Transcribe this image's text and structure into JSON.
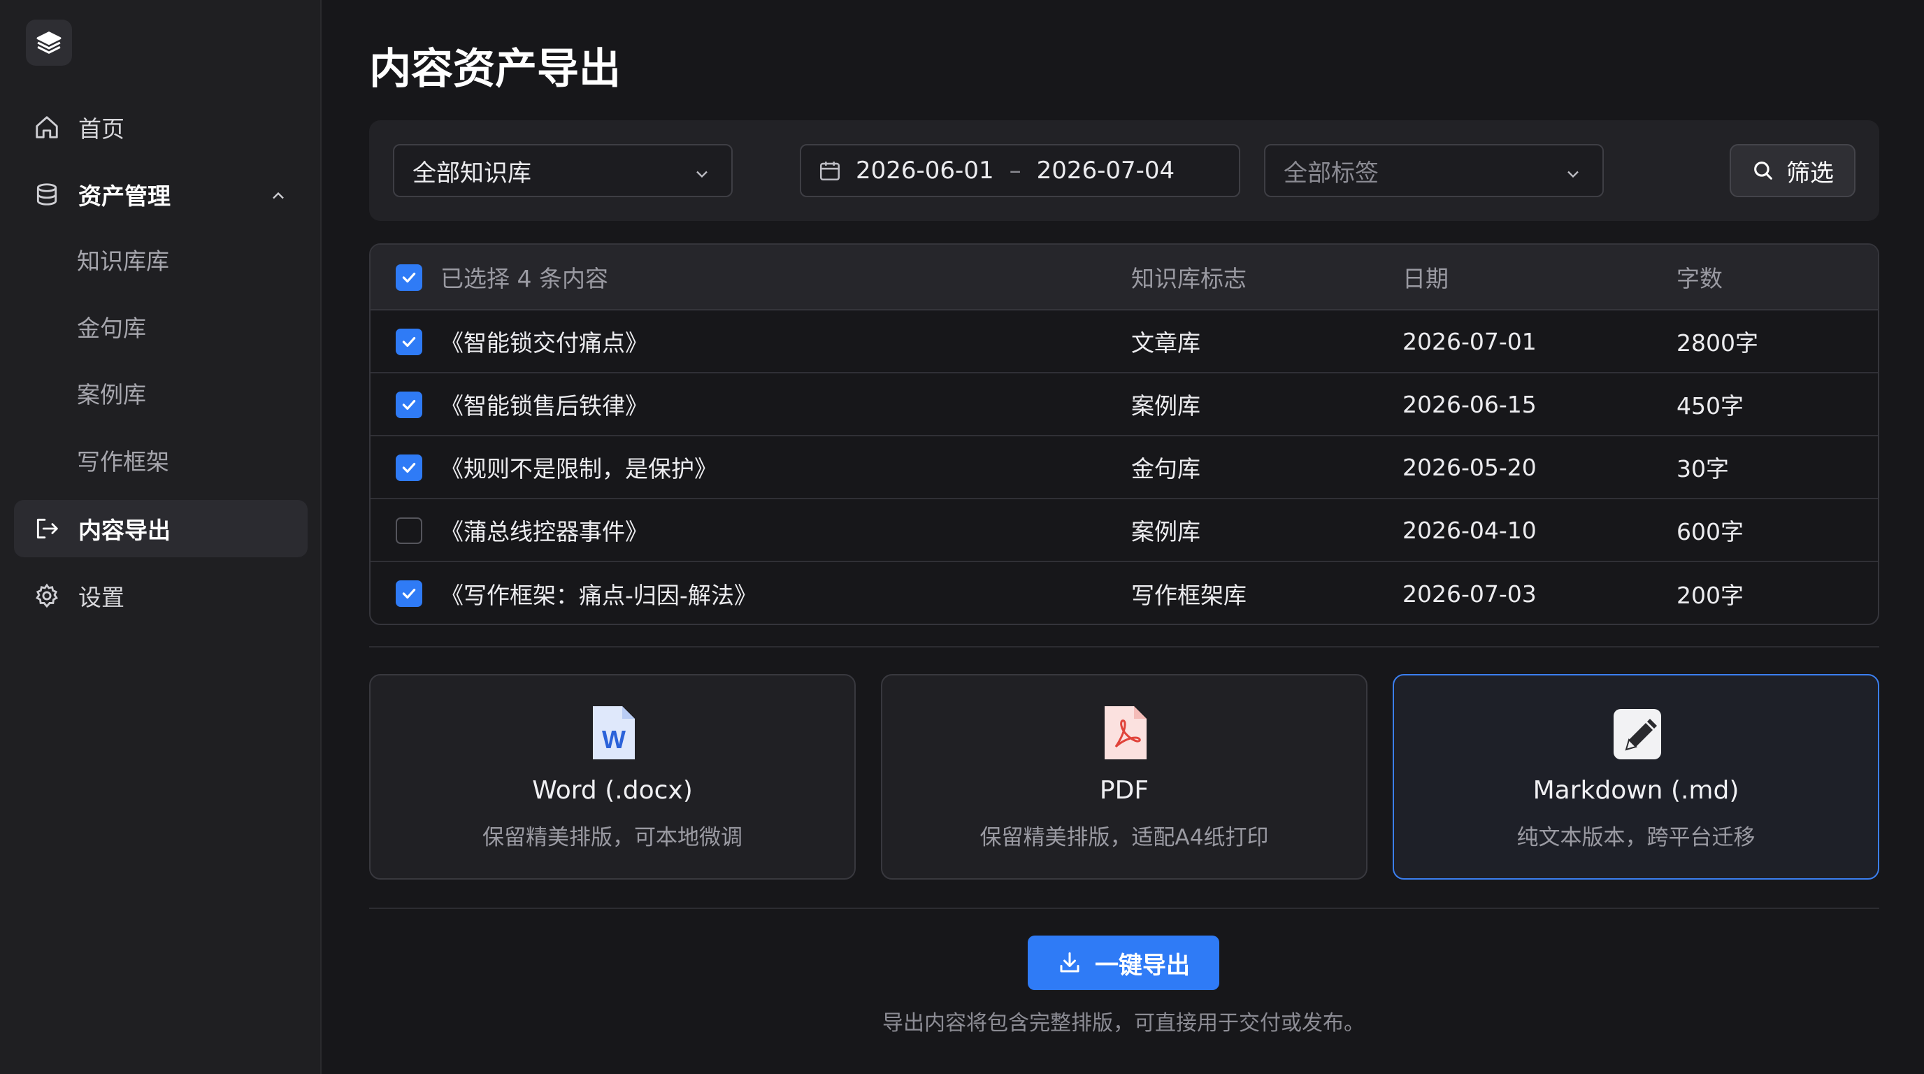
{
  "sidebar": {
    "logo_icon": "layers-icon",
    "items": [
      {
        "label": "首页",
        "icon": "home-icon"
      },
      {
        "label": "资产管理",
        "icon": "database-icon"
      },
      {
        "label": "内容导出",
        "icon": "export-icon"
      },
      {
        "label": "设置",
        "icon": "gear-icon"
      }
    ],
    "sub_items": [
      {
        "label": "知识库库"
      },
      {
        "label": "金句库"
      },
      {
        "label": "案例库"
      },
      {
        "label": "写作框架"
      }
    ]
  },
  "page": {
    "title": "内容资产导出"
  },
  "filters": {
    "library": "全部知识库",
    "date_start": "2026-06-01",
    "date_sep": "–",
    "date_end": "2026-07-04",
    "tags_placeholder": "全部标签",
    "filter_button": "筛选"
  },
  "table": {
    "header": {
      "selected_text": "已选择 4 条内容",
      "col_library": "知识库标志",
      "col_date": "日期",
      "col_words": "字数"
    },
    "rows": [
      {
        "title": "《智能锁交付痛点》",
        "library": "文章库",
        "date": "2026-07-01",
        "words": "2800字",
        "checked": true
      },
      {
        "title": "《智能锁售后铁律》",
        "library": "案例库",
        "date": "2026-06-15",
        "words": "450字",
        "checked": true
      },
      {
        "title": "《规则不是限制，是保护》",
        "library": "金句库",
        "date": "2026-05-20",
        "words": "30字",
        "checked": true
      },
      {
        "title": "《蒲总线控器事件》",
        "library": "案例库",
        "date": "2026-04-10",
        "words": "600字",
        "checked": false
      },
      {
        "title": "《写作框架：痛点-归因-解法》",
        "library": "写作框架库",
        "date": "2026-07-03",
        "words": "200字",
        "checked": true
      }
    ]
  },
  "formats": [
    {
      "title": "Word (.docx)",
      "desc": "保留精美排版，可本地微调",
      "icon": "word-file-icon",
      "color": "#2b62d9"
    },
    {
      "title": "PDF",
      "desc": "保留精美排版，适配A4纸打印",
      "icon": "pdf-file-icon",
      "color": "#e0433a"
    },
    {
      "title": "Markdown (.md)",
      "desc": "纯文本版本，跨平台迁移",
      "icon": "markdown-edit-icon",
      "color": "#2a2a2e",
      "selected": true
    }
  ],
  "export": {
    "button": "一键导出",
    "note": "导出内容将包含完整排版，可直接用于交付或发布。"
  },
  "colors": {
    "accent": "#2f7bf6",
    "background": "#17171a",
    "sidebar": "#1f1f22"
  }
}
